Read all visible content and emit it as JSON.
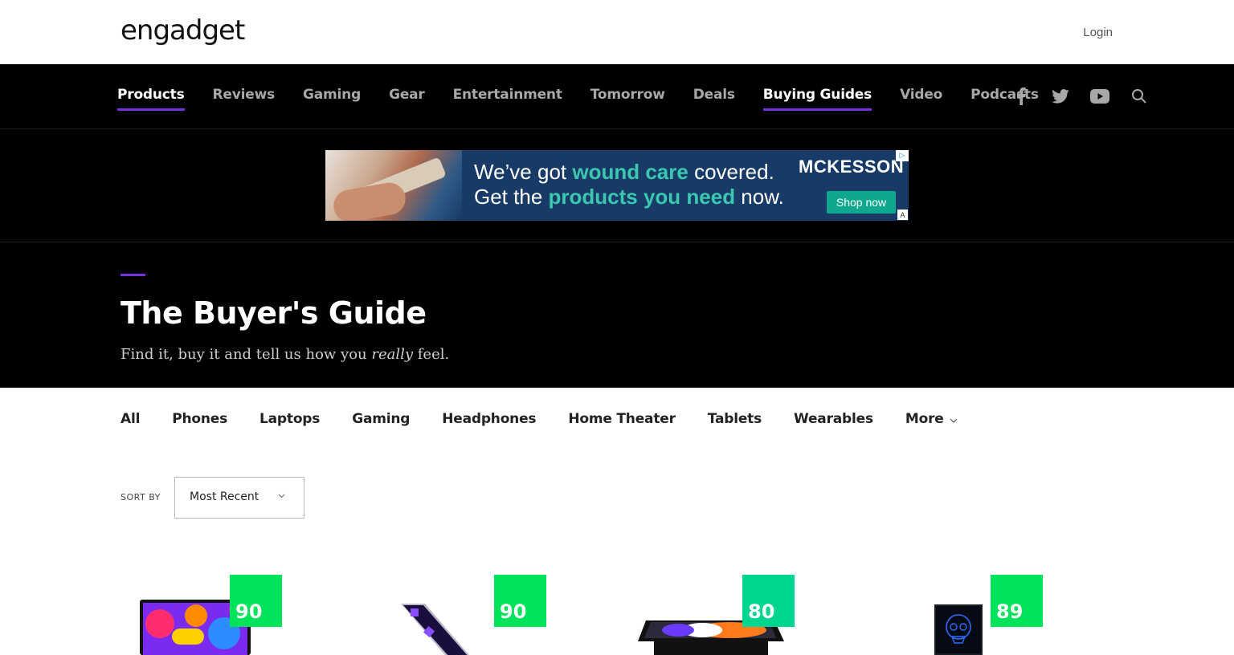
{
  "header": {
    "logo": "engadget",
    "login_label": "Login"
  },
  "nav": {
    "items": [
      {
        "label": "Products",
        "active": true
      },
      {
        "label": "Reviews",
        "active": false
      },
      {
        "label": "Gaming",
        "active": false
      },
      {
        "label": "Gear",
        "active": false
      },
      {
        "label": "Entertainment",
        "active": false
      },
      {
        "label": "Tomorrow",
        "active": false
      },
      {
        "label": "Deals",
        "active": false
      },
      {
        "label": "Buying Guides",
        "active": true
      },
      {
        "label": "Video",
        "active": false
      },
      {
        "label": "Podcasts",
        "active": false
      }
    ],
    "social_icons": [
      "facebook-icon",
      "twitter-icon",
      "youtube-icon",
      "search-icon"
    ],
    "accent_color": "#7b2ee0"
  },
  "ad": {
    "line1_pre": "We’ve got ",
    "line1_hl": "wound care",
    "line1_post": " covered.",
    "line2_pre": "Get the ",
    "line2_hl": "products you need",
    "line2_post": " now.",
    "brand": "MCKESSON",
    "cta": "Shop now",
    "choice_icon": "ad-choices-icon",
    "mark": "A"
  },
  "hero": {
    "title": "The Buyer's Guide",
    "subtitle_pre": "Find it, buy it and tell us how you ",
    "subtitle_em": "really",
    "subtitle_post": " feel."
  },
  "categories": [
    "All",
    "Phones",
    "Laptops",
    "Gaming",
    "Headphones",
    "Home Theater",
    "Tablets",
    "Wearables",
    "More"
  ],
  "sort": {
    "label": "SORT BY",
    "value": "Most Recent"
  },
  "products": [
    {
      "score": "90",
      "score_color": "#00e35b",
      "image": "laptop-image"
    },
    {
      "score": "90",
      "score_color": "#00e35b",
      "image": "phone-image"
    },
    {
      "score": "80",
      "score_color": "#00d68f",
      "image": "tablet-image"
    },
    {
      "score": "89",
      "score_color": "#00e35b",
      "image": "mini-pc-image"
    }
  ]
}
